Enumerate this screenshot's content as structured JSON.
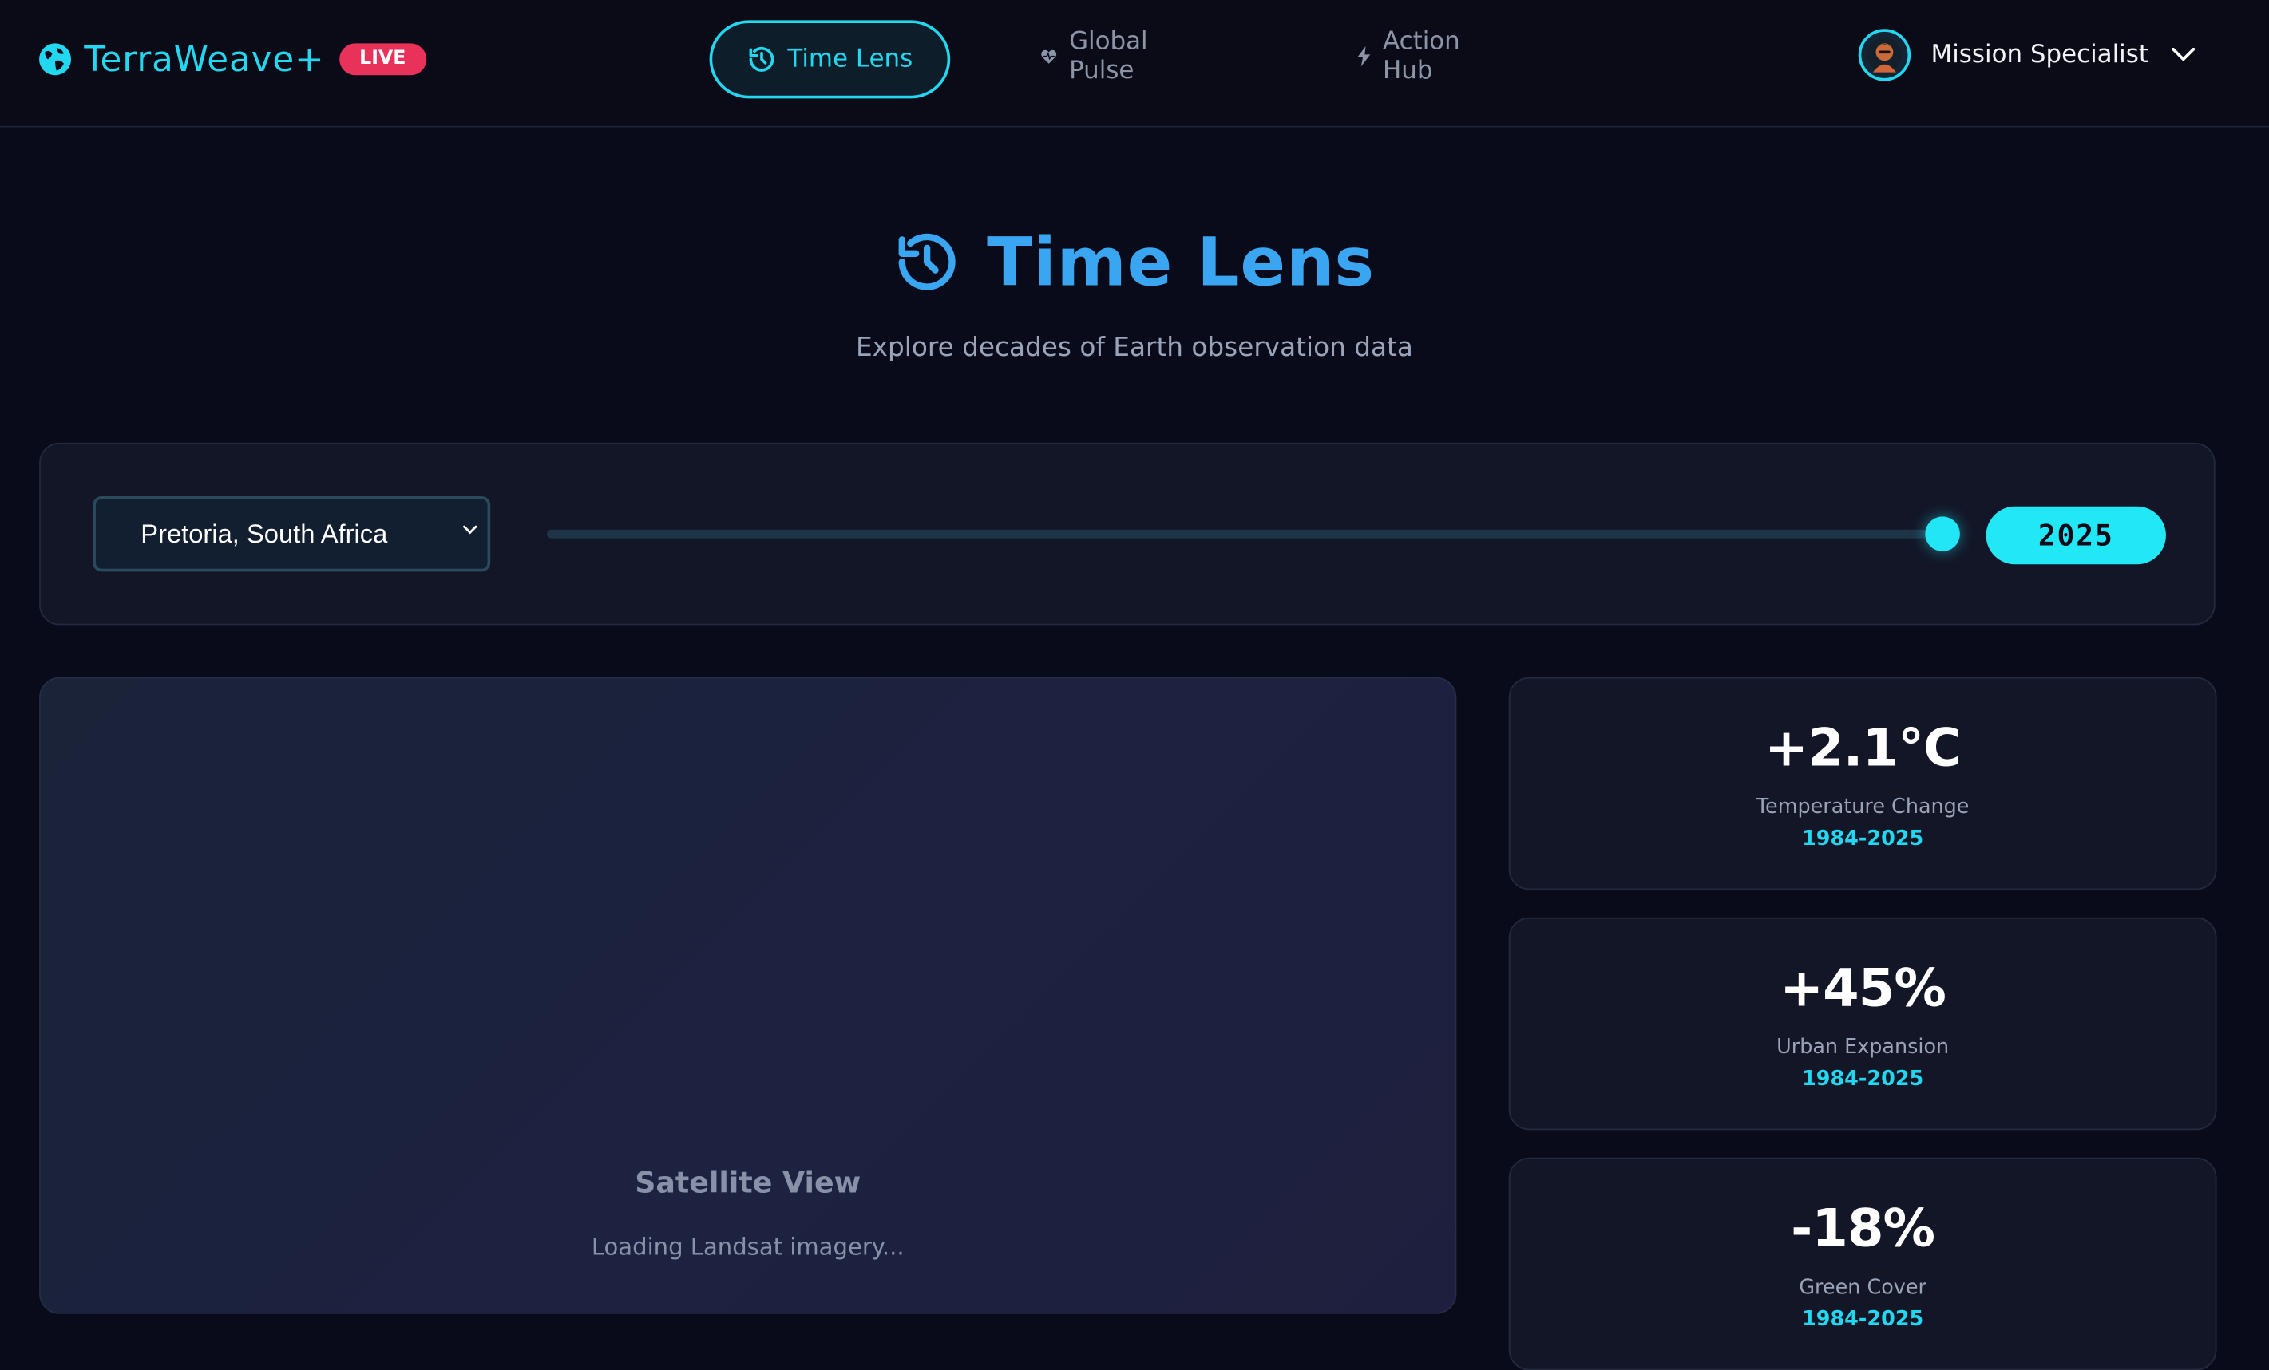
{
  "app": {
    "name": "TerraWeave+",
    "live_badge": "LIVE"
  },
  "nav": {
    "items": [
      {
        "label": "Time Lens",
        "icon": "history-icon",
        "active": true
      },
      {
        "label": "Global Pulse",
        "icon": "heart-pulse-icon",
        "active": false
      },
      {
        "label": "Action Hub",
        "icon": "bolt-icon",
        "active": false
      }
    ]
  },
  "user": {
    "name": "Mission Specialist"
  },
  "page": {
    "title": "Time Lens",
    "subtitle": "Explore decades of Earth observation data"
  },
  "controls": {
    "location": "Pretoria, South Africa",
    "year": "2025",
    "year_range": [
      1984,
      2025
    ],
    "slider_value": 2025
  },
  "satellite": {
    "title": "Satellite View",
    "status": "Loading Landsat imagery..."
  },
  "stats": [
    {
      "value": "+2.1°C",
      "label": "Temperature Change",
      "period": "1984-2025"
    },
    {
      "value": "+45%",
      "label": "Urban Expansion",
      "period": "1984-2025"
    },
    {
      "value": "-18%",
      "label": "Green Cover",
      "period": "1984-2025"
    }
  ],
  "colors": {
    "accent": "#22d8f0",
    "title": "#3aa6f2",
    "live": "#e8325a",
    "background": "#0a0b1a"
  }
}
